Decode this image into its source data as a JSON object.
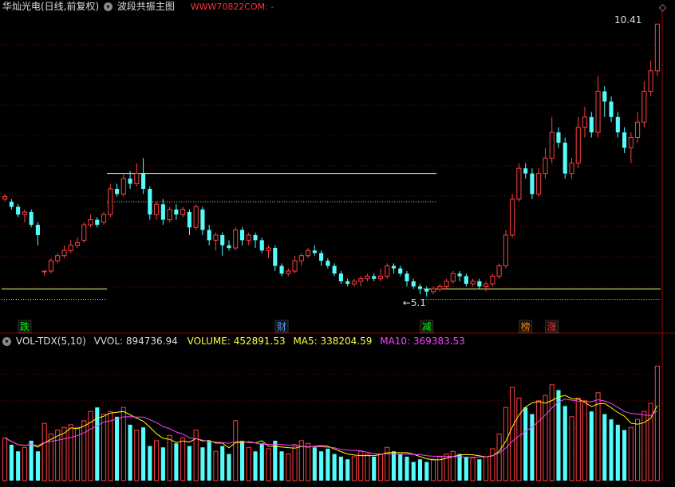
{
  "header": {
    "stock_title": "华灿光电(日线,前复权)",
    "indicator_name": "波段共振主图",
    "watermark": "WWW70822COM: -",
    "max_price_label": "10.41",
    "min_price_label": "5.1"
  },
  "volume_header": {
    "indicator": "VOL-TDX(5,10)",
    "vvol_label": "VVOL: 894736.94",
    "volume_label": "VOLUME: 452891.53",
    "ma5_label": "MA5: 338204.59",
    "ma10_label": "MA10: 369383.53"
  },
  "signals": [
    {
      "label": "跌",
      "index": 3,
      "color": "#00ff00"
    },
    {
      "label": "财",
      "index": 42,
      "color": "#5599ff"
    },
    {
      "label": "减",
      "index": 64,
      "color": "#00ff00"
    },
    {
      "label": "榜",
      "index": 79,
      "color": "#ff8800"
    },
    {
      "label": "涨",
      "index": 83,
      "color": "#ff3333"
    }
  ],
  "colors": {
    "up": "#ff4040",
    "down": "#54fcfc",
    "ma5": "#ffff00",
    "ma10": "#ff40ff",
    "hline": "#ffff80",
    "grid": "#800000"
  },
  "chart_data": {
    "type": "candlestick",
    "price_ylim": [
      4.7,
      10.6
    ],
    "candles": [
      [
        7.0,
        7.05,
        6.95,
        7.1
      ],
      [
        6.95,
        6.85,
        6.8,
        7.0
      ],
      [
        6.85,
        6.7,
        6.65,
        6.9
      ],
      [
        6.7,
        6.75,
        6.55,
        6.8
      ],
      [
        6.75,
        6.5,
        6.45,
        6.8
      ],
      [
        6.5,
        6.3,
        6.1,
        6.55
      ],
      [
        5.6,
        5.6,
        5.5,
        5.6
      ],
      [
        5.6,
        5.8,
        5.55,
        5.85
      ],
      [
        5.8,
        5.9,
        5.75,
        5.95
      ],
      [
        5.9,
        6.0,
        5.85,
        6.1
      ],
      [
        6.0,
        6.1,
        5.95,
        6.2
      ],
      [
        6.1,
        6.15,
        6.05,
        6.25
      ],
      [
        6.2,
        6.5,
        6.15,
        6.55
      ],
      [
        6.5,
        6.6,
        6.45,
        6.7
      ],
      [
        6.6,
        6.5,
        6.45,
        6.65
      ],
      [
        6.55,
        6.7,
        6.5,
        6.75
      ],
      [
        6.7,
        7.2,
        6.65,
        7.3
      ],
      [
        7.2,
        7.1,
        7.05,
        7.3
      ],
      [
        7.1,
        7.4,
        7.05,
        7.5
      ],
      [
        7.4,
        7.3,
        7.2,
        7.55
      ],
      [
        7.3,
        7.5,
        7.25,
        7.7
      ],
      [
        7.5,
        7.2,
        7.1,
        7.8
      ],
      [
        7.2,
        6.7,
        6.6,
        7.25
      ],
      [
        6.7,
        6.9,
        6.6,
        6.95
      ],
      [
        6.9,
        6.6,
        6.5,
        7.0
      ],
      [
        6.6,
        6.8,
        6.55,
        6.85
      ],
      [
        6.8,
        6.7,
        6.6,
        6.9
      ],
      [
        6.7,
        6.8,
        6.65,
        6.85
      ],
      [
        6.75,
        6.45,
        6.3,
        6.8
      ],
      [
        6.45,
        6.85,
        6.4,
        6.9
      ],
      [
        6.8,
        6.4,
        6.3,
        6.85
      ],
      [
        6.4,
        6.2,
        6.1,
        6.5
      ],
      [
        6.2,
        6.3,
        6.0,
        6.35
      ],
      [
        6.3,
        6.1,
        5.9,
        6.35
      ],
      [
        6.1,
        6.05,
        6.0,
        6.2
      ],
      [
        6.05,
        6.4,
        6.0,
        6.45
      ],
      [
        6.4,
        6.2,
        6.1,
        6.45
      ],
      [
        6.2,
        6.3,
        6.1,
        6.35
      ],
      [
        6.3,
        6.2,
        6.05,
        6.35
      ],
      [
        6.2,
        6.0,
        5.95,
        6.25
      ],
      [
        6.0,
        6.05,
        5.85,
        6.1
      ],
      [
        6.05,
        5.7,
        5.6,
        6.1
      ],
      [
        5.7,
        5.55,
        5.5,
        5.75
      ],
      [
        5.55,
        5.6,
        5.5,
        5.65
      ],
      [
        5.6,
        5.8,
        5.55,
        5.9
      ],
      [
        5.8,
        5.9,
        5.7,
        5.95
      ],
      [
        5.9,
        6.0,
        5.85,
        6.05
      ],
      [
        6.0,
        5.95,
        5.9,
        6.1
      ],
      [
        5.95,
        5.8,
        5.7,
        6.0
      ],
      [
        5.8,
        5.7,
        5.65,
        5.85
      ],
      [
        5.7,
        5.55,
        5.5,
        5.75
      ],
      [
        5.55,
        5.4,
        5.35,
        5.6
      ],
      [
        5.4,
        5.35,
        5.3,
        5.45
      ],
      [
        5.35,
        5.4,
        5.3,
        5.45
      ],
      [
        5.4,
        5.45,
        5.3,
        5.5
      ],
      [
        5.45,
        5.5,
        5.4,
        5.55
      ],
      [
        5.5,
        5.45,
        5.4,
        5.55
      ],
      [
        5.45,
        5.5,
        5.4,
        5.65
      ],
      [
        5.5,
        5.7,
        5.45,
        5.75
      ],
      [
        5.7,
        5.65,
        5.55,
        5.75
      ],
      [
        5.65,
        5.55,
        5.5,
        5.7
      ],
      [
        5.55,
        5.4,
        5.3,
        5.6
      ],
      [
        5.4,
        5.3,
        5.25,
        5.45
      ],
      [
        5.3,
        5.25,
        5.15,
        5.35
      ],
      [
        5.25,
        5.2,
        5.1,
        5.3
      ],
      [
        5.2,
        5.25,
        5.15,
        5.3
      ],
      [
        5.25,
        5.3,
        5.2,
        5.35
      ],
      [
        5.3,
        5.4,
        5.25,
        5.45
      ],
      [
        5.4,
        5.55,
        5.35,
        5.6
      ],
      [
        5.55,
        5.5,
        5.4,
        5.6
      ],
      [
        5.5,
        5.35,
        5.3,
        5.55
      ],
      [
        5.35,
        5.4,
        5.3,
        5.45
      ],
      [
        5.4,
        5.3,
        5.25,
        5.45
      ],
      [
        5.3,
        5.35,
        5.2,
        5.4
      ],
      [
        5.35,
        5.5,
        5.3,
        5.55
      ],
      [
        5.5,
        5.7,
        5.45,
        5.75
      ],
      [
        5.7,
        6.3,
        5.65,
        6.4
      ],
      [
        6.3,
        7.0,
        6.25,
        7.1
      ],
      [
        7.0,
        7.6,
        6.95,
        7.7
      ],
      [
        7.6,
        7.5,
        7.4,
        7.7
      ],
      [
        7.5,
        7.1,
        7.0,
        7.6
      ],
      [
        7.1,
        7.5,
        7.05,
        7.6
      ],
      [
        7.5,
        7.8,
        7.4,
        8.0
      ],
      [
        7.8,
        8.3,
        7.7,
        8.6
      ],
      [
        8.3,
        8.1,
        8.0,
        8.4
      ],
      [
        8.1,
        7.5,
        7.4,
        8.2
      ],
      [
        7.5,
        7.7,
        7.4,
        7.8
      ],
      [
        7.7,
        8.4,
        7.6,
        8.6
      ],
      [
        8.4,
        8.6,
        8.2,
        8.8
      ],
      [
        8.6,
        8.3,
        8.2,
        8.7
      ],
      [
        8.3,
        9.1,
        8.2,
        9.4
      ],
      [
        9.1,
        8.9,
        8.6,
        9.2
      ],
      [
        8.9,
        8.6,
        8.5,
        9.0
      ],
      [
        8.6,
        8.3,
        8.2,
        8.7
      ],
      [
        8.3,
        8.0,
        7.9,
        8.4
      ],
      [
        8.0,
        8.2,
        7.7,
        8.3
      ],
      [
        8.2,
        8.5,
        8.1,
        8.7
      ],
      [
        8.5,
        9.1,
        8.4,
        9.3
      ],
      [
        9.1,
        9.5,
        9.0,
        9.7
      ],
      [
        9.5,
        10.41,
        9.4,
        10.41
      ]
    ],
    "volumes": [
      0.32,
      0.27,
      0.22,
      0.25,
      0.3,
      0.22,
      0.43,
      0.35,
      0.38,
      0.4,
      0.42,
      0.4,
      0.45,
      0.52,
      0.55,
      0.5,
      0.52,
      0.48,
      0.55,
      0.42,
      0.38,
      0.4,
      0.26,
      0.3,
      0.25,
      0.34,
      0.28,
      0.32,
      0.26,
      0.38,
      0.25,
      0.3,
      0.22,
      0.26,
      0.2,
      0.45,
      0.3,
      0.25,
      0.22,
      0.28,
      0.24,
      0.3,
      0.22,
      0.2,
      0.26,
      0.3,
      0.28,
      0.25,
      0.22,
      0.24,
      0.2,
      0.18,
      0.16,
      0.18,
      0.22,
      0.2,
      0.18,
      0.2,
      0.25,
      0.22,
      0.2,
      0.18,
      0.14,
      0.16,
      0.14,
      0.16,
      0.18,
      0.2,
      0.22,
      0.2,
      0.18,
      0.17,
      0.16,
      0.18,
      0.24,
      0.35,
      0.55,
      0.7,
      0.62,
      0.55,
      0.5,
      0.6,
      0.64,
      0.72,
      0.68,
      0.56,
      0.48,
      0.62,
      0.6,
      0.52,
      0.66,
      0.5,
      0.46,
      0.42,
      0.38,
      0.4,
      0.46,
      0.52,
      0.58,
      0.86
    ],
    "hlines": [
      {
        "price": 7.5,
        "from": 16,
        "to": 65,
        "style": "solid"
      },
      {
        "price": 6.95,
        "from": 16,
        "to": 65,
        "style": "dotted"
      },
      {
        "price": 5.25,
        "from": 0,
        "to": 15,
        "style": "solid"
      },
      {
        "price": 5.05,
        "from": 0,
        "to": 15,
        "style": "dotted"
      },
      {
        "price": 5.25,
        "from": 64,
        "to": 99,
        "style": "solid"
      },
      {
        "price": 5.05,
        "from": 64,
        "to": 99,
        "style": "dotted"
      }
    ]
  }
}
